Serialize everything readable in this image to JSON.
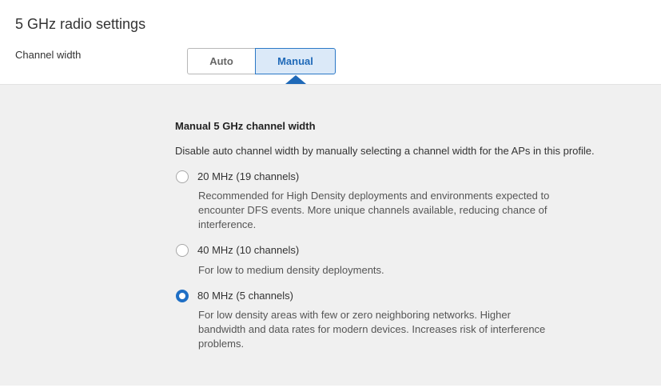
{
  "section": {
    "title": "5 GHz radio settings"
  },
  "channel_width": {
    "label": "Channel width",
    "toggle": {
      "options": [
        "Auto",
        "Manual"
      ],
      "selected": "Manual"
    }
  },
  "manual_panel": {
    "title": "Manual 5 GHz channel width",
    "description": "Disable auto channel width by manually selecting a channel width for the APs in this profile.",
    "selected_option": "80 MHz (5 channels)",
    "options": [
      {
        "label": "20 MHz (19 channels)",
        "checked": false,
        "help_lines": [
          "Recommended for High Density deployments and environments expected to",
          "encounter DFS events. More unique channels available, reducing chance of",
          "interference."
        ]
      },
      {
        "label": "40 MHz (10 channels)",
        "checked": false,
        "help_lines": [
          "For low to medium density deployments."
        ]
      },
      {
        "label": "80 MHz (5 channels)",
        "checked": true,
        "help_lines": [
          "For low density areas with few or zero neighboring networks. Higher",
          "bandwidth and data rates for modern devices. Increases risk of interference",
          "problems."
        ]
      }
    ]
  },
  "colors": {
    "accent": "#1f6fc5",
    "toggle_selected_bg": "#dbe9f8",
    "panel_bg": "#f0f0f0"
  }
}
